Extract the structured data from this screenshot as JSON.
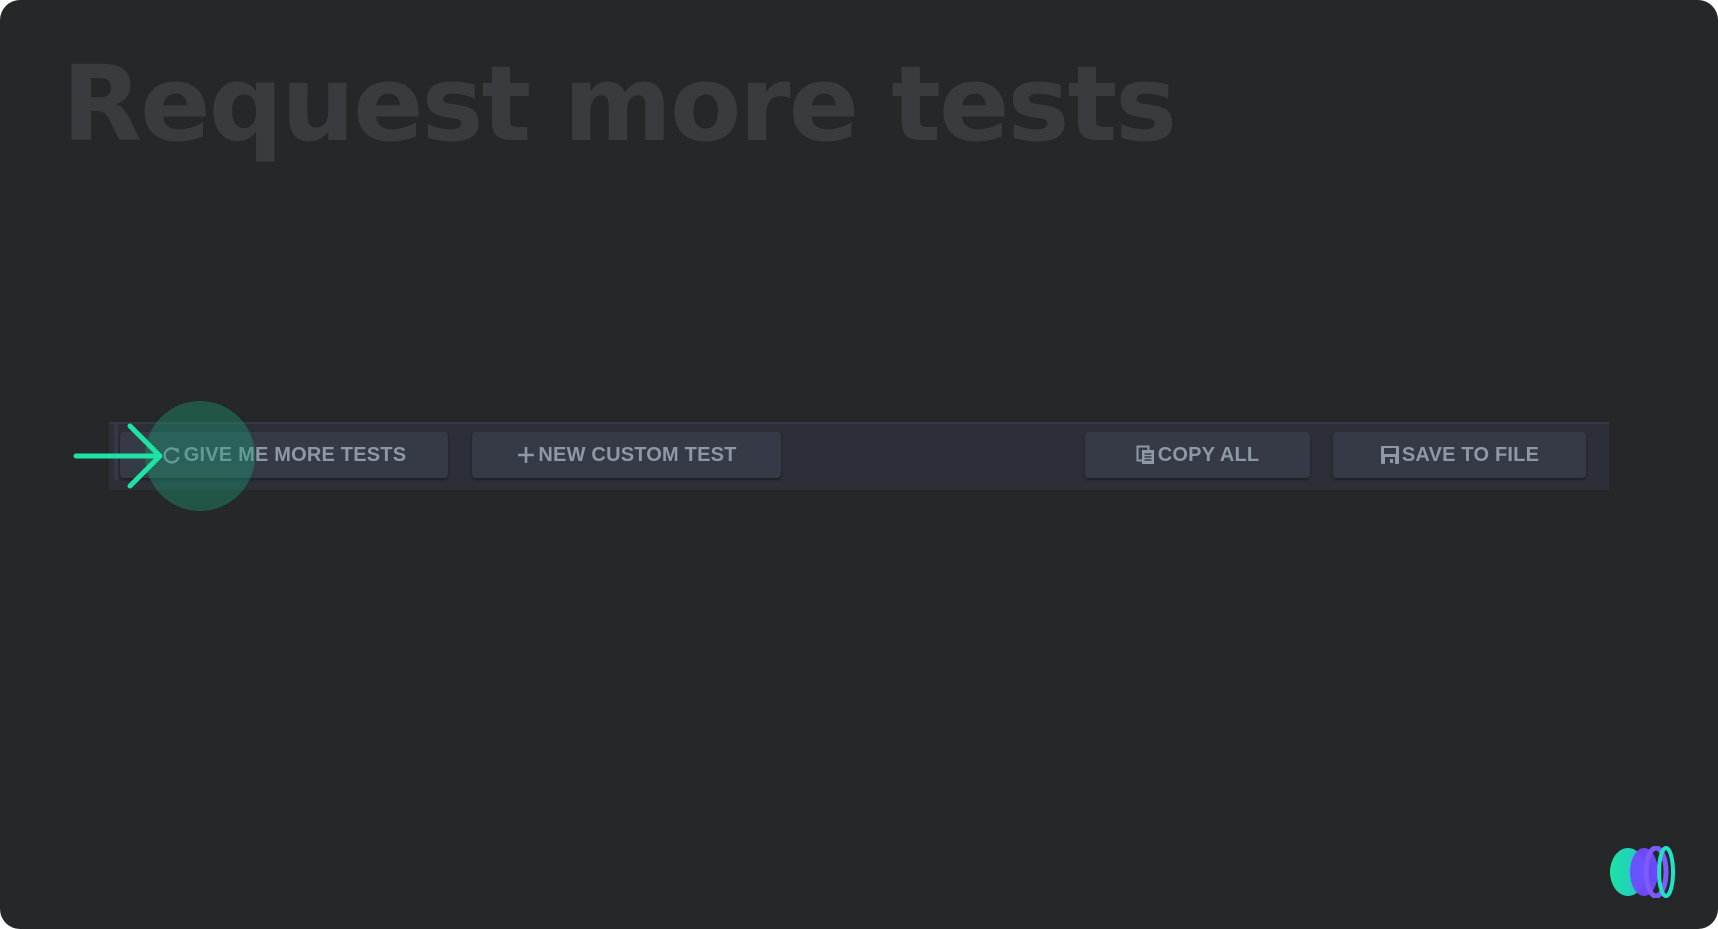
{
  "page": {
    "title": "Request more tests"
  },
  "toolbar": {
    "give_more_tests": {
      "label": "GIVE ME MORE TESTS",
      "icon": "refresh-icon"
    },
    "new_custom_test": {
      "label": "NEW CUSTOM TEST",
      "icon": "plus-icon"
    },
    "copy_all": {
      "label": "COPY ALL",
      "icon": "copy-icon"
    },
    "save_to_file": {
      "label": "SAVE TO FILE",
      "icon": "floppy-disk-icon"
    }
  },
  "overlay": {
    "pointer": "arrow-pointer-icon",
    "highlight_target": "give-more-tests-button"
  },
  "brand": {
    "logo": "brand-logo-icon"
  },
  "colors": {
    "background": "#262729",
    "title": "#3a3b3e",
    "toolbar": "#2c2f37",
    "button": "#353a46",
    "button_text": "#8e98a6",
    "accent_green": "#1ee3a4",
    "accent_purple": "#6f4bff"
  }
}
